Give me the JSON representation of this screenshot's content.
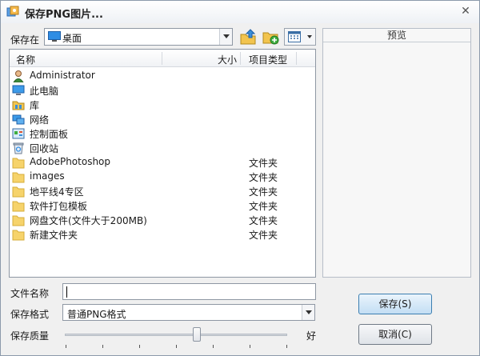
{
  "window": {
    "title": "保存PNG图片..."
  },
  "save_in": {
    "label": "保存在",
    "value": "桌面"
  },
  "columns": {
    "name": "名称",
    "size": "大小",
    "type": "项目类型"
  },
  "items": [
    {
      "name": "Administrator",
      "type": "",
      "icon": "user-icon"
    },
    {
      "name": "此电脑",
      "type": "",
      "icon": "computer-icon"
    },
    {
      "name": "库",
      "type": "",
      "icon": "library-icon"
    },
    {
      "name": "网络",
      "type": "",
      "icon": "network-icon"
    },
    {
      "name": "控制面板",
      "type": "",
      "icon": "control-panel-icon"
    },
    {
      "name": "回收站",
      "type": "",
      "icon": "recycle-bin-icon"
    },
    {
      "name": "AdobePhotoshop",
      "type": "文件夹",
      "icon": "folder-icon"
    },
    {
      "name": "images",
      "type": "文件夹",
      "icon": "folder-icon"
    },
    {
      "name": "地平线4专区",
      "type": "文件夹",
      "icon": "folder-icon"
    },
    {
      "name": "软件打包模板",
      "type": "文件夹",
      "icon": "folder-icon"
    },
    {
      "name": "网盘文件(文件大于200MB)",
      "type": "文件夹",
      "icon": "folder-icon"
    },
    {
      "name": "新建文件夹",
      "type": "文件夹",
      "icon": "folder-icon"
    }
  ],
  "preview": {
    "title": "预览"
  },
  "filename": {
    "label": "文件名称",
    "value": ""
  },
  "format": {
    "label": "保存格式",
    "value": "普通PNG格式"
  },
  "quality": {
    "label": "保存质量",
    "end_label": "好",
    "value": 0.58
  },
  "buttons": {
    "save": "保存(S)",
    "cancel": "取消(C)"
  },
  "colors": {
    "folder": "#f6d36b",
    "accent": "#3c7fb1"
  }
}
